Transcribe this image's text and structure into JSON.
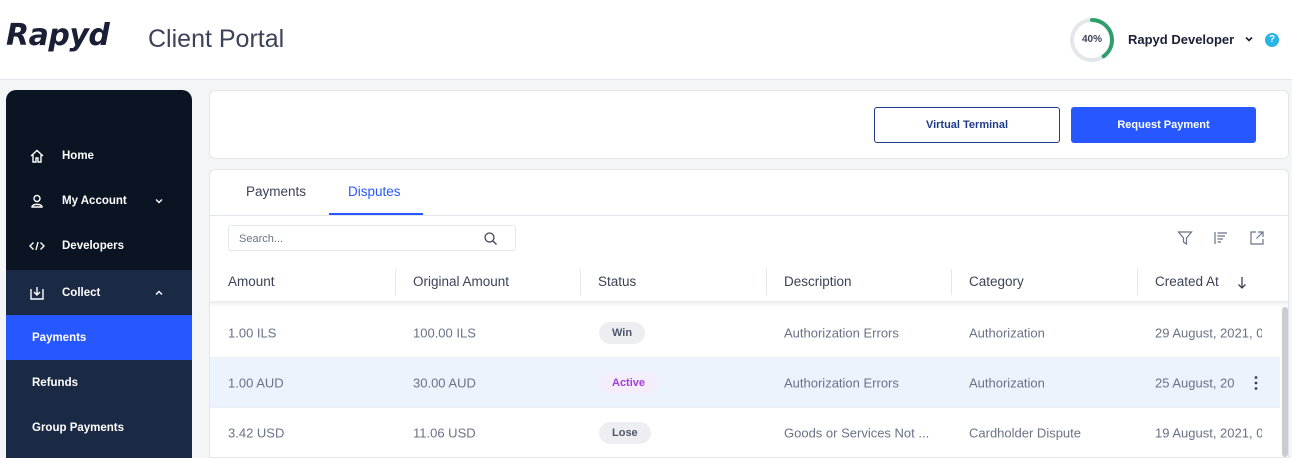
{
  "header": {
    "logo": "Rapyd",
    "title": "Client Portal",
    "progress_label": "40%",
    "progress_value": 0.4,
    "user_name": "Rapyd Developer",
    "help": "?"
  },
  "sidebar": {
    "items": [
      {
        "label": "Home",
        "icon": "home-icon"
      },
      {
        "label": "My Account",
        "icon": "user-icon"
      },
      {
        "label": "Developers",
        "icon": "code-icon"
      },
      {
        "label": "Collect",
        "icon": "collect-icon"
      }
    ],
    "sub_items": [
      {
        "label": "Payments",
        "active": true
      },
      {
        "label": "Refunds",
        "active": false
      },
      {
        "label": "Group Payments",
        "active": false
      }
    ]
  },
  "actions": {
    "virtual_terminal": "Virtual Terminal",
    "request_payment": "Request Payment"
  },
  "tabs": [
    {
      "label": "Payments",
      "active": false
    },
    {
      "label": "Disputes",
      "active": true
    }
  ],
  "search": {
    "placeholder": "Search...",
    "value": ""
  },
  "table": {
    "columns": [
      "Amount",
      "Original Amount",
      "Status",
      "Description",
      "Category",
      "Created At"
    ],
    "rows": [
      {
        "amount": "1.00 ILS",
        "original": "100.00 ILS",
        "status": "Win",
        "description": "Authorization Errors",
        "category": "Authorization",
        "created": "29 August, 2021, 0"
      },
      {
        "amount": "1.00 AUD",
        "original": "30.00 AUD",
        "status": "Active",
        "description": "Authorization Errors",
        "category": "Authorization",
        "created": "25 August, 20"
      },
      {
        "amount": "3.42 USD",
        "original": "11.06 USD",
        "status": "Lose",
        "description": "Goods or Services Not ...",
        "category": "Cardholder Dispute",
        "created": "19 August, 2021, 0"
      }
    ]
  },
  "colors": {
    "accent": "#2758ff",
    "sidebar_bg": "#0b1423",
    "active_status": "#a33ed6",
    "progress": "#2e9e6b"
  }
}
